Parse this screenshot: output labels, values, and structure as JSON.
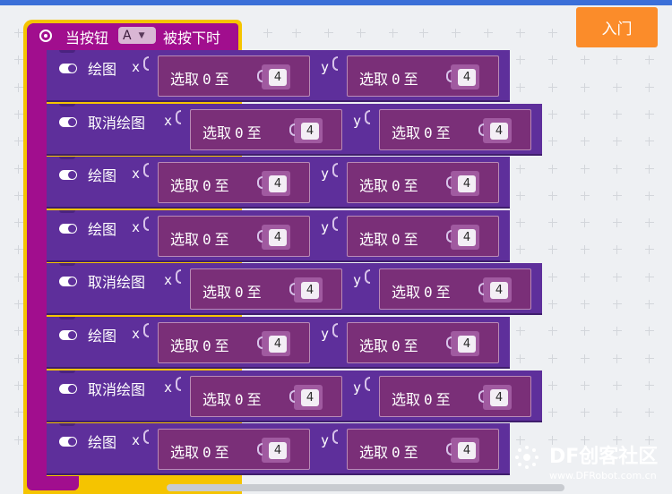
{
  "header": {
    "intro_button": "入门"
  },
  "event": {
    "text_before": "当按钮",
    "button_option": "A",
    "text_after": "被按下时"
  },
  "labels": {
    "draw": "绘图",
    "undraw": "取消绘图",
    "x": "x",
    "y": "y",
    "random": "选取",
    "zero": "0",
    "to": "至",
    "max": "4"
  },
  "statements": [
    {
      "kind": "draw"
    },
    {
      "kind": "undraw"
    },
    {
      "kind": "draw"
    },
    {
      "kind": "draw"
    },
    {
      "kind": "undraw"
    },
    {
      "kind": "draw"
    },
    {
      "kind": "undraw"
    },
    {
      "kind": "draw"
    }
  ],
  "watermark": {
    "brand": "DF创客社区",
    "url": "www.DFRobot.com.cn"
  },
  "colors": {
    "event_block": "#a10e8e",
    "event_outline": "#f5c400",
    "statement_block": "#5e2f9b",
    "random_block": "#7a2f78",
    "intro_button": "#fb8c2a"
  }
}
